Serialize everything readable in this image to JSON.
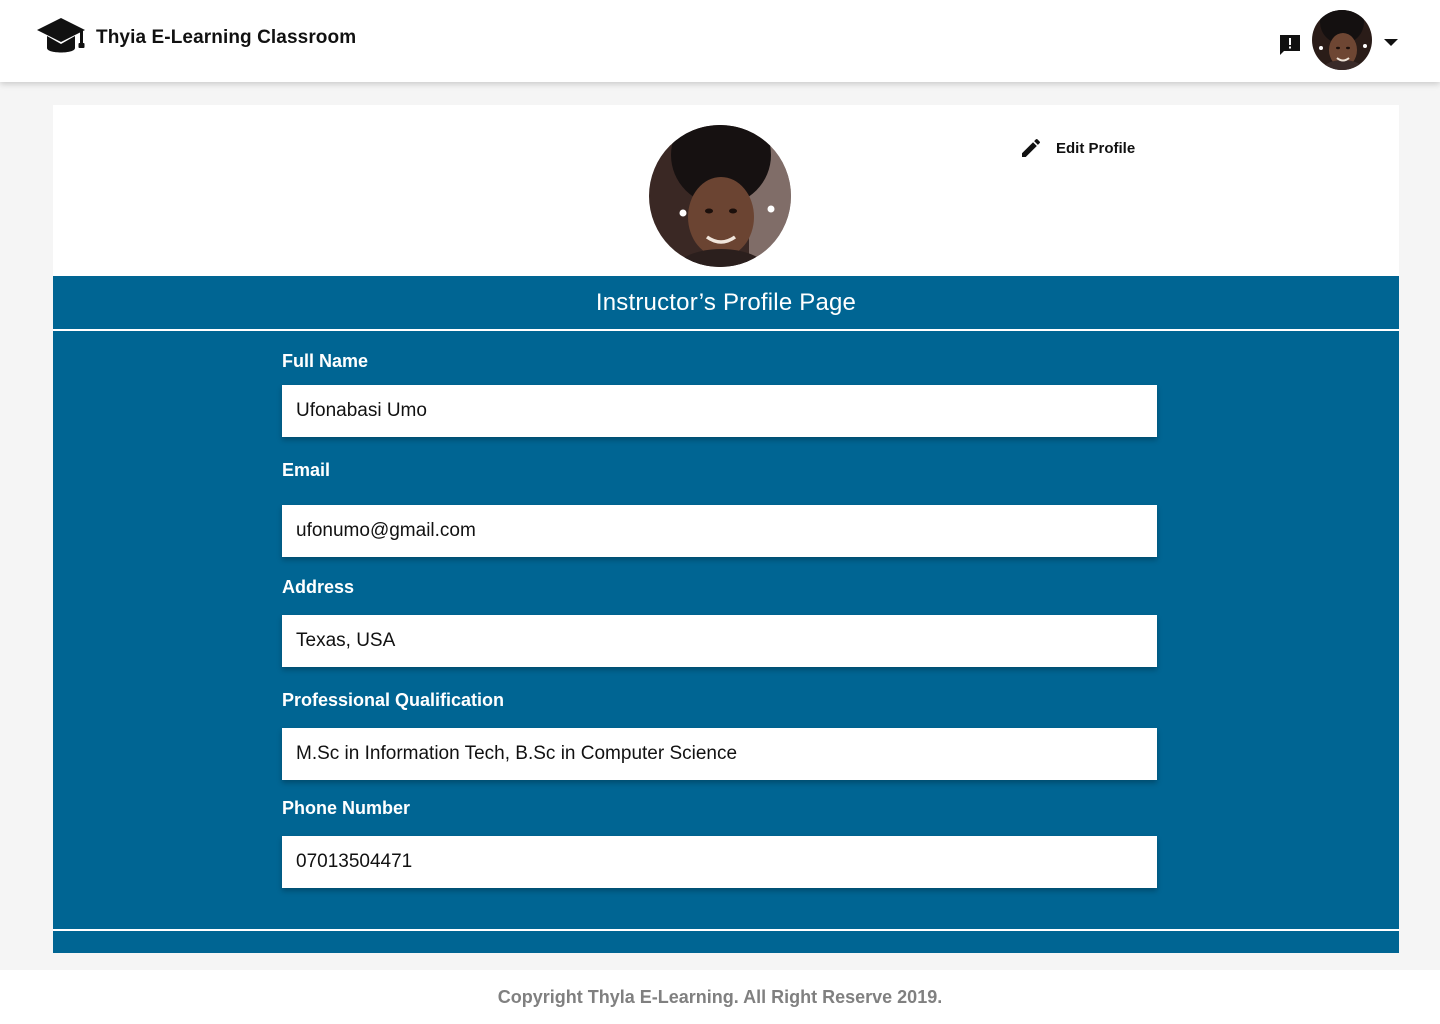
{
  "header": {
    "brand_title": "Thyia E-Learning Classroom",
    "brand_icon": "graduation-cap-icon",
    "feedback_icon": "feedback-icon",
    "user_menu_icon": "chevron-down-icon"
  },
  "profile": {
    "edit_label": "Edit Profile",
    "edit_icon": "pencil-icon",
    "page_title": "Instructor’s Profile Page",
    "fields": [
      {
        "label": "Full Name",
        "value": "Ufonabasi Umo"
      },
      {
        "label": "Email",
        "value": "ufonumo@gmail.com"
      },
      {
        "label": "Address",
        "value": "Texas, USA"
      },
      {
        "label": "Professional Qualification",
        "value": "M.Sc in Information Tech, B.Sc in Computer Science"
      },
      {
        "label": "Phone Number",
        "value": "07013504471"
      }
    ]
  },
  "footer": {
    "copyright": "Copyright Thyla E-Learning. All Right Reserve 2019."
  },
  "colors": {
    "primary": "#006593",
    "background": "#f5f5f5",
    "footer_text": "#808080"
  }
}
